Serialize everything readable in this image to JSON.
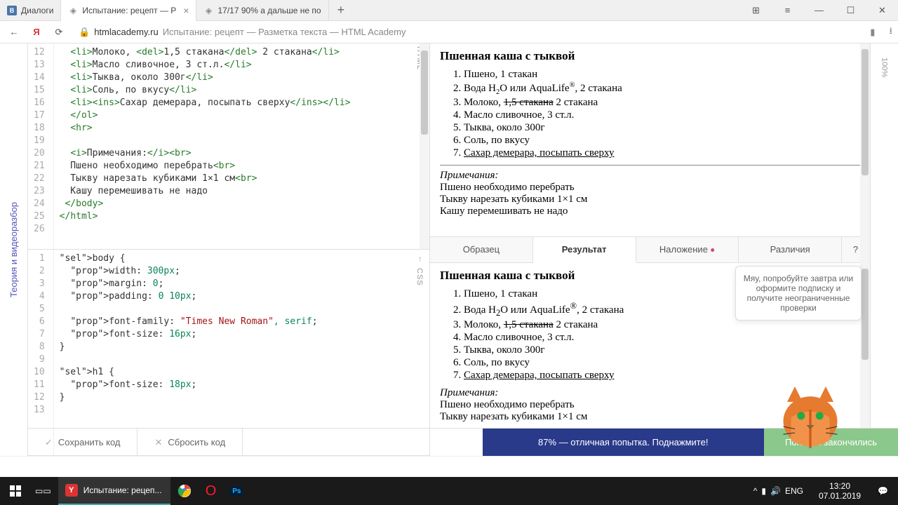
{
  "window": {
    "tabs": [
      {
        "label": "Диалоги",
        "icon": "vk"
      },
      {
        "label": "Испытание: рецепт — Р",
        "icon": "shield",
        "active": true
      },
      {
        "label": "17/17 90% а дальше не по",
        "icon": "shield"
      }
    ],
    "controls": {
      "min": "–",
      "max": "☐",
      "close": "✕"
    }
  },
  "address": {
    "back": "←",
    "yandex": "Я",
    "reload": "⟳",
    "domain": "htmlacademy.ru",
    "path": "Испытание: рецепт — Разметка текста — HTML Academy",
    "bookmark": "🔖",
    "download": "⭳"
  },
  "leftRail": "Теория и видеоразбор",
  "rightRail": "100%",
  "htmlEditor": {
    "label": "HTML",
    "startLine": 12,
    "lines": [
      "  <li>Молоко, <del>1,5 стакана</del> 2 стакана</li>",
      "  <li>Масло сливочное, 3 ст.л.</li>",
      "  <li>Тыква, около 300г</li>",
      "  <li>Соль, по вкусу</li>",
      "  <li><ins>Сахар демерара, посыпать сверху</ins></li>",
      "  </ol>",
      "  <hr>",
      "",
      "  <i>Примечания:</i><br>",
      "  Пшено необходимо перебрать<br>",
      "  Тыкву нарезать кубиками 1×1 см<br>",
      "  Кашу перемешивать не надо",
      " </body>",
      "</html>",
      ""
    ]
  },
  "cssEditor": {
    "label": "CSS",
    "arrow": "↑",
    "startLine": 1,
    "lines": [
      "body {",
      "  width: 300px;",
      "  margin: 0;",
      "  padding: 0 10px;",
      "",
      "  font-family: \"Times New Roman\", serif;",
      "  font-size: 16px;",
      "}",
      "",
      "h1 {",
      "  font-size: 18px;",
      "}",
      ""
    ]
  },
  "preview": {
    "heading": "Пшенная каша с тыквой",
    "items": [
      {
        "text": "Пшено, 1 стакан"
      },
      {
        "html": "Вода H<sub>2</sub>O или AquaLife<sup>®</sup>, 2 стакана"
      },
      {
        "html": "Молоко, <del>1,5 стакана</del> 2 стакана"
      },
      {
        "text": "Масло сливочное, 3 ст.л."
      },
      {
        "text": "Тыква, около 300г"
      },
      {
        "text": "Соль, по вкусу"
      },
      {
        "html": "<span class='ins'>Сахар демерара, посыпать сверху</span>"
      }
    ],
    "notesHeading": "Примечания:",
    "notes": [
      "Пшено необходимо перебрать",
      "Тыкву нарезать кубиками 1×1 см",
      "Кашу перемешивать не надо"
    ]
  },
  "previewTabs": {
    "sample": "Образец",
    "result": "Результат",
    "overlay": "Наложение",
    "diff": "Различия",
    "help": "?"
  },
  "tooltip": "Мяу, попробуйте завтра или оформите подписку и получите неограниченные проверки",
  "bottomBar": {
    "save": "Сохранить код",
    "reset": "Сбросить код",
    "score": "87% — отличная попытка. Поднажмите!",
    "attempts": "Попытки закончились"
  },
  "taskbar": {
    "appTitle": "Испытание: рецеп...",
    "lang": "ENG",
    "time": "13:20",
    "date": "07.01.2019"
  }
}
